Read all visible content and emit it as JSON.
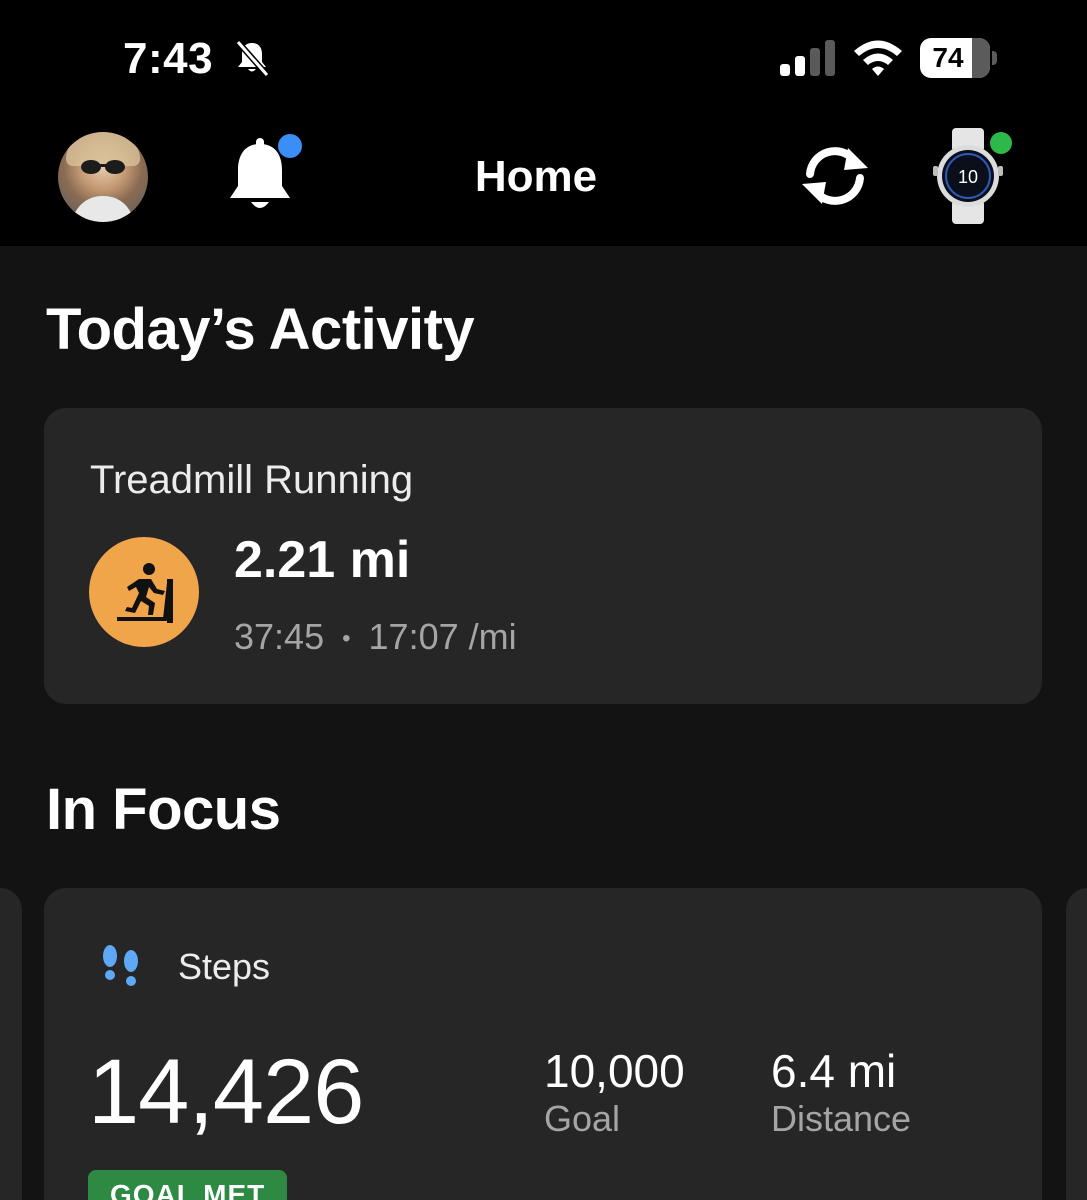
{
  "status_bar": {
    "time": "7:43",
    "battery_percent": "74",
    "signal_icon": "cellular-signal-icon",
    "wifi_icon": "wifi-icon",
    "mute_icon": "bell-slash-icon"
  },
  "header": {
    "title": "Home",
    "notification_indicator_color": "#3a8ef6",
    "device_connected_color": "#2fb84a"
  },
  "todays_activity": {
    "section_title": "Today’s Activity",
    "activity": {
      "name": "Treadmill Running",
      "distance": "2.21 mi",
      "duration": "37:45",
      "separator": "•",
      "pace": "17:07 /mi",
      "icon": "treadmill-runner-icon",
      "icon_color": "#f0a54a"
    }
  },
  "in_focus": {
    "section_title": "In Focus",
    "steps_card": {
      "title": "Steps",
      "count": "14,426",
      "goal_value": "10,000",
      "goal_label": "Goal",
      "distance_value": "6.4 mi",
      "distance_label": "Distance",
      "badge": "GOAL MET",
      "badge_color": "#2e8a42",
      "icon": "footprints-icon",
      "icon_color": "#5ea8f5"
    }
  }
}
